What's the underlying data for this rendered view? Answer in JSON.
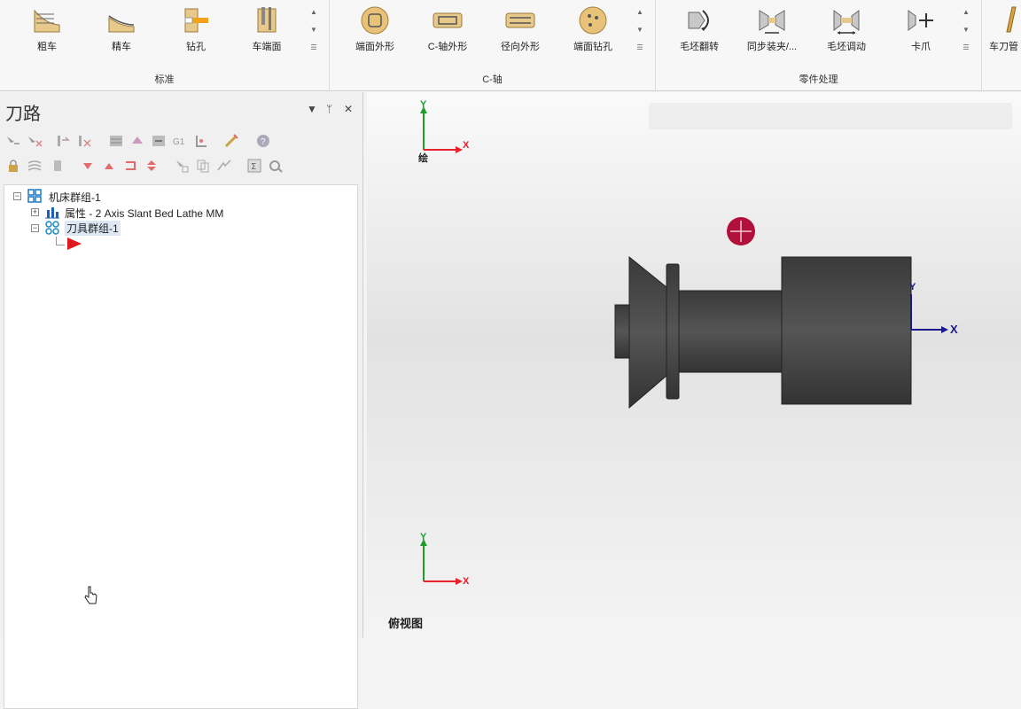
{
  "ribbon": {
    "groups": [
      {
        "label": "标准",
        "buttons": [
          {
            "label": "粗车"
          },
          {
            "label": "精车"
          },
          {
            "label": "钻孔"
          },
          {
            "label": "车端面"
          }
        ]
      },
      {
        "label": "C-轴",
        "buttons": [
          {
            "label": "端面外形"
          },
          {
            "label": "C-轴外形"
          },
          {
            "label": "径向外形"
          },
          {
            "label": "端面钻孔"
          }
        ]
      },
      {
        "label": "零件处理",
        "buttons": [
          {
            "label": "毛坯翻转"
          },
          {
            "label": "同步装夹/..."
          },
          {
            "label": "毛坯调动"
          },
          {
            "label": "卡爪"
          }
        ]
      }
    ],
    "extra_button": {
      "label": "车刀管"
    }
  },
  "panel": {
    "title": "刀路",
    "controls": {
      "dropdown": "▼",
      "pin": "ᛘ",
      "close": "✕"
    },
    "tree": {
      "machine_group": "机床群组-1",
      "properties": "属性 - 2 Axis Slant Bed Lathe MM",
      "toolpath_group": "刀具群组-1",
      "expanded_symbol": "−",
      "collapsed_symbol": "+"
    }
  },
  "viewport": {
    "gizmo_top": {
      "x": "X",
      "y": "Y",
      "label": "绘"
    },
    "gizmo_part": {
      "x": "X",
      "y": "Y"
    },
    "gizmo_bottom": {
      "x": "X",
      "y": "Y"
    },
    "view_name": "俯视图"
  },
  "colors": {
    "axis_x": "#e8212b",
    "axis_y": "#1f9c2a",
    "part_axis": "#1a1a8c",
    "part": "#4a4a4a",
    "origin": "#b0103a"
  }
}
